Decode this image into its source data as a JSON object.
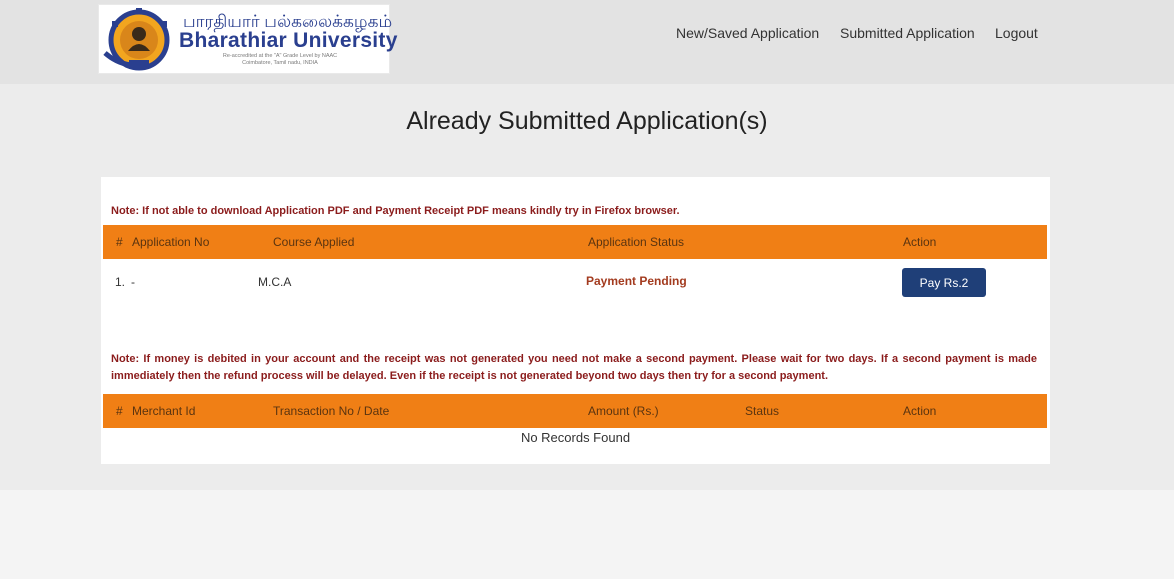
{
  "header": {
    "university_tamil": "பாரதியார் பல்கலைக்கழகம்",
    "university_name": "Bharathiar University",
    "accreditation": "Re-accredited at the \"A\" Grade Level by NAAC",
    "location": "Coimbatore, Tamil nadu, INDIA",
    "nav": {
      "new_saved": "New/Saved Application",
      "submitted": "Submitted Application",
      "logout": "Logout"
    }
  },
  "page_title": "Already Submitted Application(s)",
  "note1": "Note: If not able to download Application PDF and Payment Receipt PDF means kindly try in Firefox browser.",
  "applications": {
    "headers": {
      "hash": "#",
      "application_no": "Application No",
      "course": "Course Applied",
      "status": "Application Status",
      "action": "Action"
    },
    "rows": [
      {
        "index": "1.",
        "application_no": "-",
        "course": "M.C.A",
        "status": "Payment Pending",
        "action_label": "Pay Rs.2"
      }
    ]
  },
  "note2": "Note: If money is debited in your account and the receipt was not generated you need not make a second payment. Please wait for two days. If a second payment is made immediately then the refund process will be delayed. Even if the receipt is not generated beyond two days then try for a second payment.",
  "payments": {
    "headers": {
      "hash": "#",
      "merchant_id": "Merchant Id",
      "transaction": "Transaction No / Date",
      "amount": "Amount (Rs.)",
      "status": "Status",
      "action": "Action"
    },
    "empty_message": "No Records Found"
  },
  "colors": {
    "header_bg": "#e3e3e3",
    "table_header": "#f07f15",
    "note_text": "#8b1c1c",
    "pay_button": "#1f3f78",
    "brand_blue": "#2a3f8f"
  },
  "icons": {
    "logo": "university-seal-icon"
  }
}
